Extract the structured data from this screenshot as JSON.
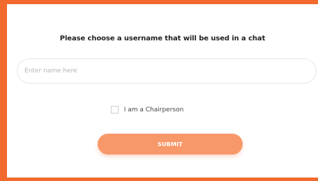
{
  "form": {
    "heading": "Please choose a username that will be used in a chat",
    "name_input": {
      "value": "",
      "placeholder": "Enter name here"
    },
    "chairperson_checkbox": {
      "label": "I am a Chairperson",
      "checked": false
    },
    "submit_label": "SUBMIT"
  },
  "colors": {
    "frame_border": "#f26a2e",
    "submit_background": "#f7986a",
    "submit_text": "#ffffff"
  }
}
